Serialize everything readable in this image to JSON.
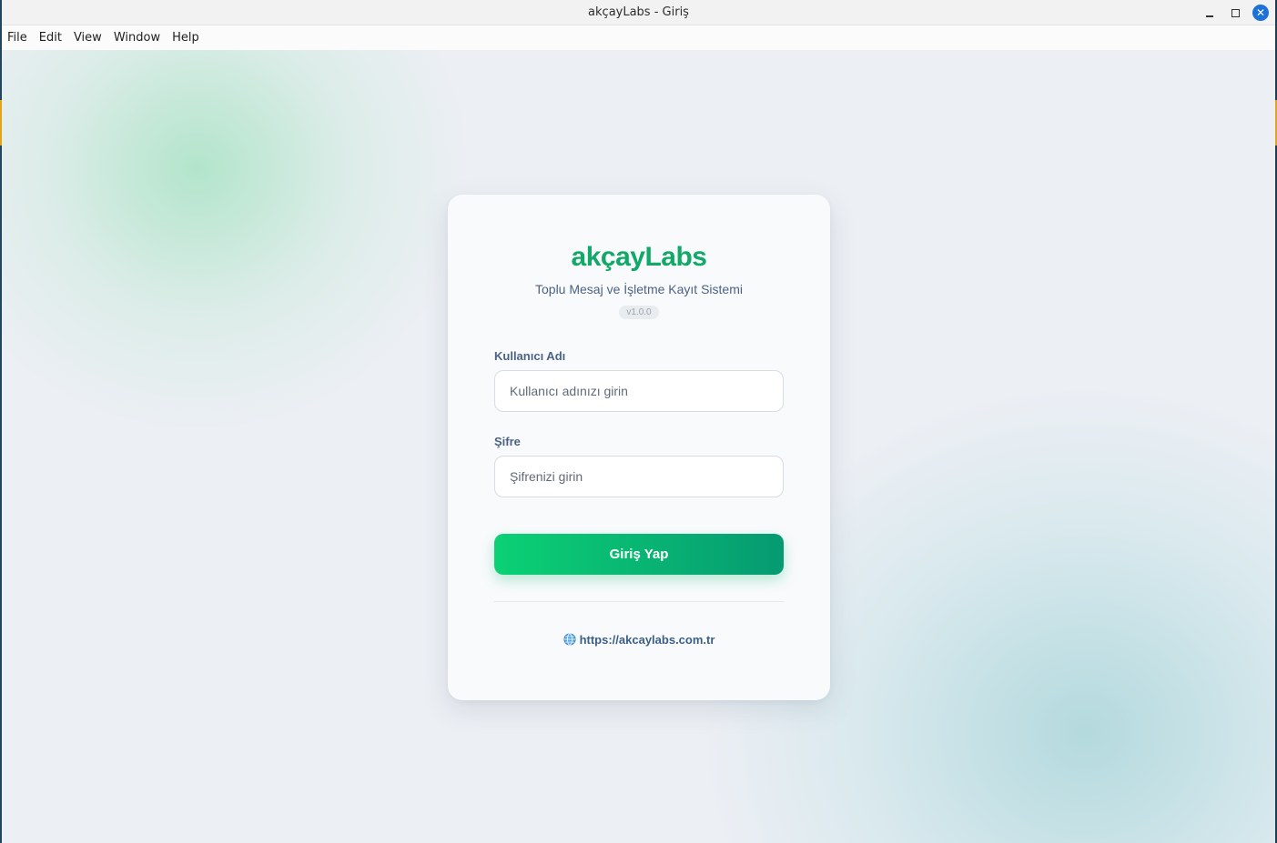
{
  "window": {
    "title": "akçayLabs - Giriş",
    "close_glyph": "✕"
  },
  "menubar": {
    "items": [
      "File",
      "Edit",
      "View",
      "Window",
      "Help"
    ]
  },
  "login": {
    "brand": "akçayLabs",
    "subtitle": "Toplu Mesaj ve İşletme Kayıt Sistemi",
    "version": "v1.0.0",
    "username_label": "Kullanıcı Adı",
    "username_placeholder": "Kullanıcı adınızı girin",
    "username_value": "",
    "password_label": "Şifre",
    "password_placeholder": "Şifrenizi girin",
    "password_value": "",
    "submit_label": "Giriş Yap",
    "website_link": "https://akcaylabs.com.tr",
    "website_icon": "globe-icon"
  },
  "colors": {
    "brand": "#12a868",
    "button_start": "#0bd174",
    "button_end": "#069a72",
    "text_muted": "#4b6384",
    "close_button": "#1c72d6"
  }
}
